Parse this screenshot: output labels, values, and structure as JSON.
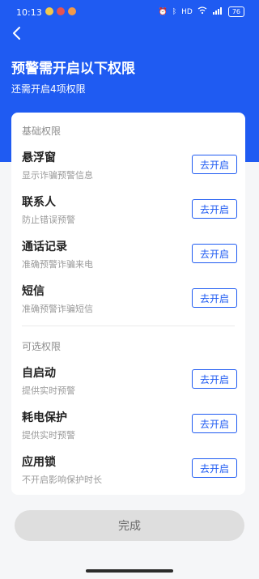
{
  "status_bar": {
    "time": "10:13",
    "right_text": "HD",
    "battery": "76"
  },
  "header": {
    "title": "预警需开启以下权限",
    "subtitle": "还需开启4项权限"
  },
  "sections": [
    {
      "label": "基础权限",
      "items": [
        {
          "title": "悬浮窗",
          "desc": "显示诈骗预警信息",
          "button": "去开启"
        },
        {
          "title": "联系人",
          "desc": "防止错误预警",
          "button": "去开启"
        },
        {
          "title": "通话记录",
          "desc": "准确预警诈骗来电",
          "button": "去开启"
        },
        {
          "title": "短信",
          "desc": "准确预警诈骗短信",
          "button": "去开启"
        }
      ]
    },
    {
      "label": "可选权限",
      "items": [
        {
          "title": "自启动",
          "desc": "提供实时预警",
          "button": "去开启"
        },
        {
          "title": "耗电保护",
          "desc": "提供实时预警",
          "button": "去开启"
        },
        {
          "title": "应用锁",
          "desc": "不开启影响保护时长",
          "button": "去开启"
        }
      ]
    }
  ],
  "footer": {
    "done_label": "完成"
  },
  "colors": {
    "accent": "#1f5bf2",
    "background": "#f5f6f8",
    "button_disabled": "#dedede"
  }
}
